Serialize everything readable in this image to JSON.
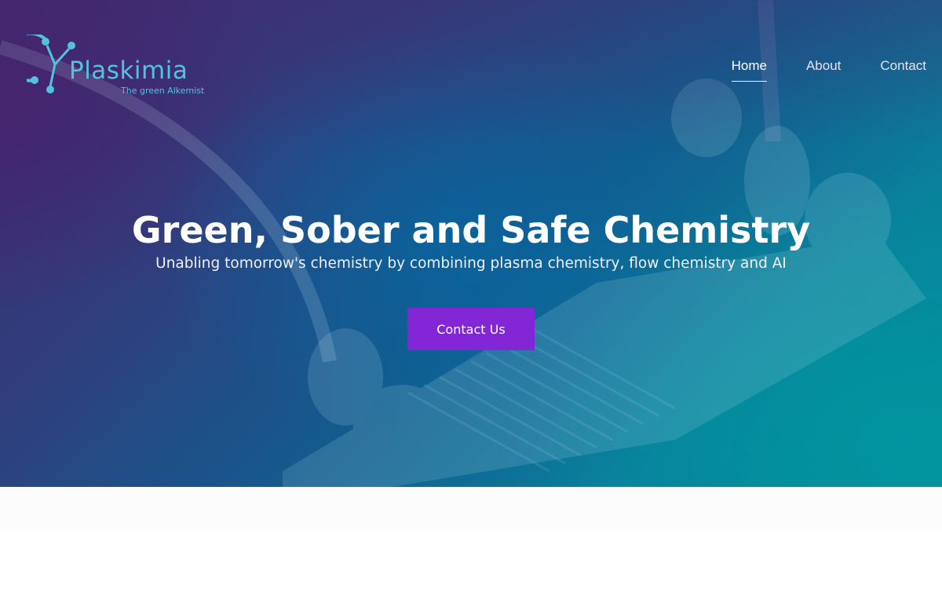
{
  "brand": {
    "name": "Plaskimia",
    "tagline": "The green Alkemist",
    "color": "#53c3dd"
  },
  "nav": {
    "items": [
      {
        "label": "Home",
        "active": true
      },
      {
        "label": "About",
        "active": false
      },
      {
        "label": "Contact",
        "active": false
      }
    ]
  },
  "hero": {
    "title": "Green, Sober and Safe Chemistry",
    "subtitle": "Unabling tomorrow's chemistry by combining plasma chemistry, flow chemistry and AI",
    "cta_label": "Contact Us",
    "cta_color": "#8226d6"
  },
  "icons": [
    "atom-logo-icon"
  ]
}
